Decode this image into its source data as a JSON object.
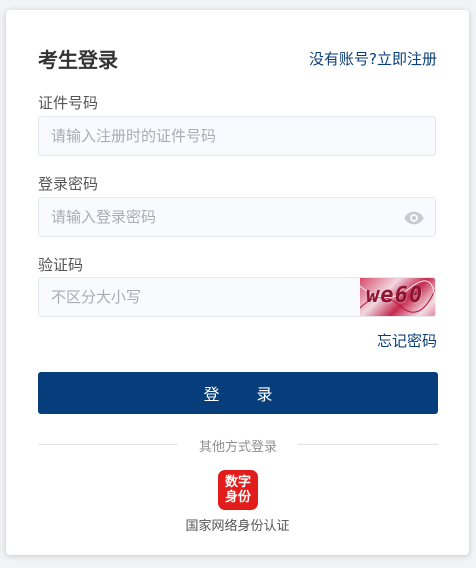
{
  "header": {
    "title": "考生登录",
    "register_link": "没有账号?立即注册"
  },
  "fields": {
    "id_number": {
      "label": "证件号码",
      "placeholder": "请输入注册时的证件号码",
      "value": ""
    },
    "password": {
      "label": "登录密码",
      "placeholder": "请输入登录密码",
      "value": "",
      "toggle_icon": "eye-icon"
    },
    "captcha": {
      "label": "验证码",
      "placeholder": "不区分大小写",
      "value": "",
      "image_text": "we60"
    }
  },
  "actions": {
    "forgot_password": "忘记密码",
    "login_button": "登 录"
  },
  "alt_login": {
    "divider_text": "其他方式登录",
    "logo_line1": "数字",
    "logo_line2": "身份",
    "label": "国家网络身份认证"
  },
  "colors": {
    "accent": "#063d7a",
    "link": "#0b3f78",
    "logo_red": "#e21b1b"
  }
}
